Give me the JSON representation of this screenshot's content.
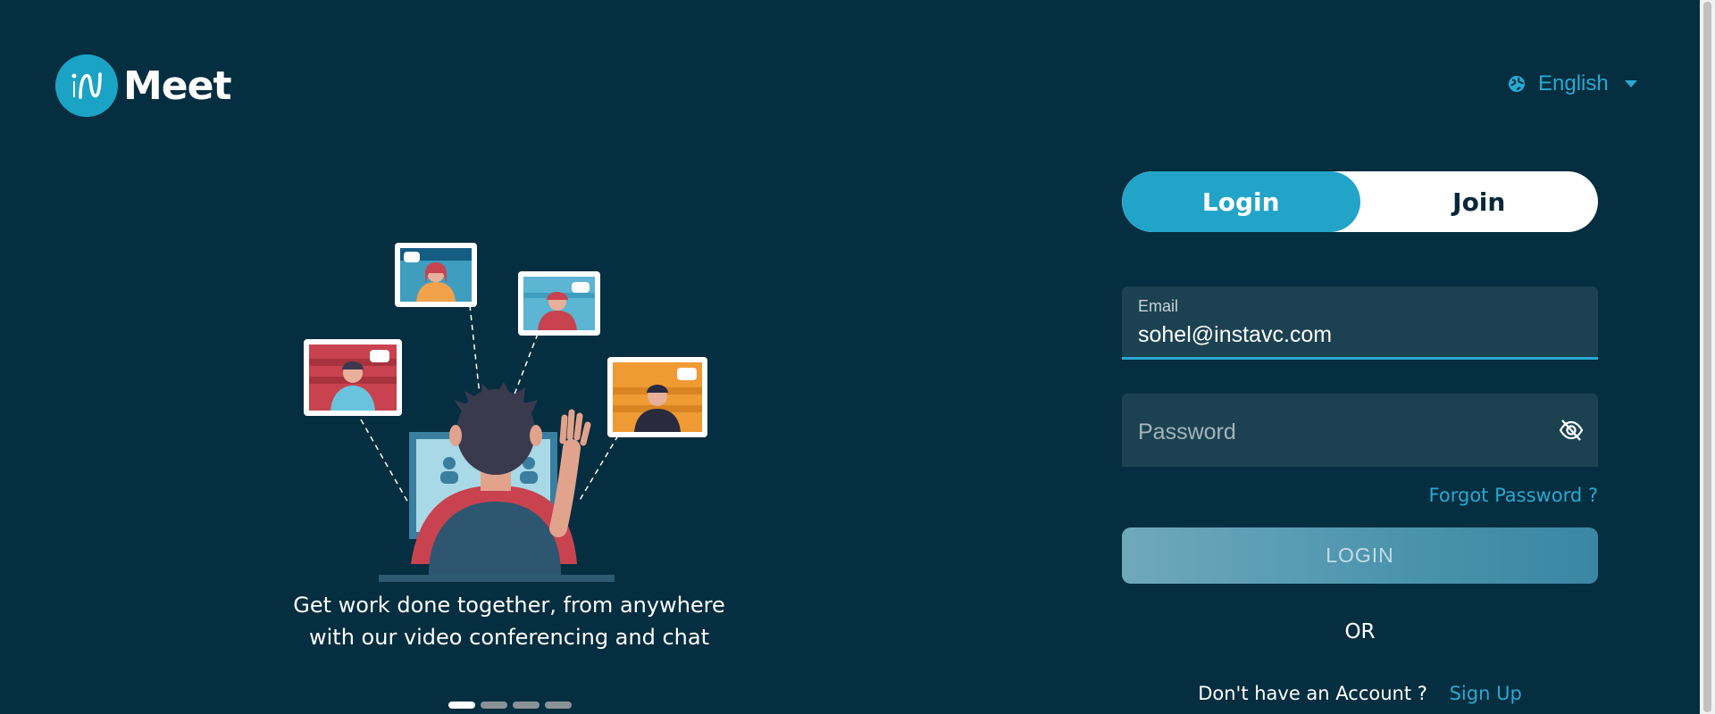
{
  "brand": {
    "name": "Meet",
    "badge_glyph": "iN",
    "accent": "#1ba3c6"
  },
  "language": {
    "selected": "English",
    "icon": "globe-icon"
  },
  "hero": {
    "tagline_line1": "Get work done together, from anywhere",
    "tagline_line2": "with our video conferencing and chat",
    "slides": 4,
    "active_slide": 1
  },
  "auth_tabs": [
    {
      "label": "Login",
      "active": true
    },
    {
      "label": "Join",
      "active": false
    }
  ],
  "form": {
    "email_label": "Email",
    "email_value": "sohel@instavc.com",
    "password_placeholder": "Password",
    "password_value": "",
    "forgot_label": "Forgot Password ?",
    "login_button": "LOGIN",
    "or_label": "OR",
    "no_account_label": "Don't have an Account ?",
    "signup_label": "Sign Up"
  },
  "colors": {
    "background": "#052e40",
    "primary": "#22a4c8",
    "link": "#28a9cf",
    "field": "#1c4252"
  }
}
